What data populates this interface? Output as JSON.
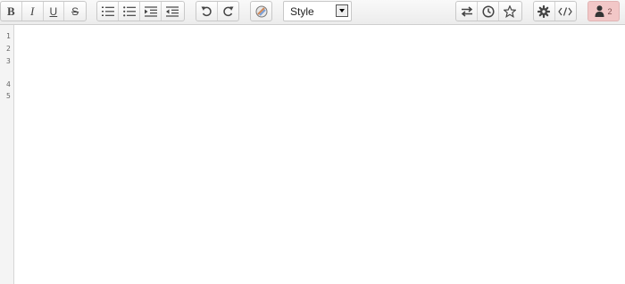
{
  "toolbar": {
    "format": {
      "bold": "B",
      "italic": "I",
      "underline": "U",
      "strike": "S"
    },
    "style_select": {
      "value": "Style"
    },
    "users": {
      "count": "2"
    }
  },
  "icons": [
    "bold-icon",
    "italic-icon",
    "underline-icon",
    "strikethrough-icon",
    "ordered-list-icon",
    "unordered-list-icon",
    "indent-icon",
    "outdent-icon",
    "undo-icon",
    "redo-icon",
    "color-icon",
    "import-export-icon",
    "history-icon",
    "star-icon",
    "gear-icon",
    "code-icon",
    "user-icon"
  ],
  "colors": {
    "users_badge": "#f2c7c7",
    "toolbar_bg": "#ececec"
  },
  "gutter": {
    "line_numbers": [
      "1",
      "2",
      "3",
      "4",
      "5"
    ]
  }
}
